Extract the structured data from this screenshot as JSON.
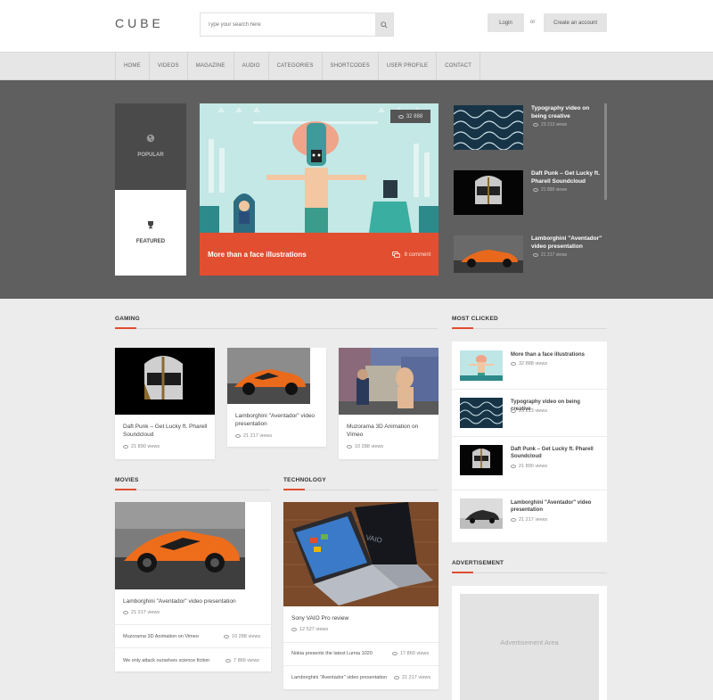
{
  "header": {
    "logo": "CUBE",
    "search_placeholder": "Type your search here",
    "login_label": "Login",
    "or_label": "or",
    "create_label": "Create an account"
  },
  "nav": {
    "items": [
      "HOME",
      "VIDEOS",
      "MAGAZINE",
      "AUDIO",
      "CATEGORIES",
      "SHORTCODES",
      "USER PROFILE",
      "CONTACT"
    ]
  },
  "hero": {
    "tabs": [
      {
        "label": "POPULAR",
        "icon": "globe-icon"
      },
      {
        "label": "FEATURED",
        "icon": "trophy-icon"
      }
    ],
    "featured": {
      "title": "More than a face illustrations",
      "views": "32 888",
      "comments": "8 comment"
    },
    "side": [
      {
        "title": "Typography video on being creative",
        "views": "23 213 views"
      },
      {
        "title": "Daft Punk – Get Lucky ft. Pharell Soundcloud",
        "views": "21 890 views"
      },
      {
        "title": "Lamborghini \"Aventador\" video presentation",
        "views": "21 217 views"
      }
    ]
  },
  "gaming": {
    "heading": "GAMING",
    "cards": [
      {
        "title": "Daft Punk – Get Lucky ft. Pharell Soundcloud",
        "views": "21 890 views"
      },
      {
        "title": "Lamborghini \"Aventador\" video presentation",
        "views": "21 217 views"
      },
      {
        "title": "Muzorama 3D Animation on Vimeo",
        "views": "10 288 views"
      }
    ]
  },
  "movies": {
    "heading": "MOVIES",
    "main": {
      "title": "Lamborghini \"Aventador\" video presentation",
      "views": "21 217 views"
    },
    "list": [
      {
        "title": "Muzorama 3D Animation on Vimeo",
        "views": "10 288 views"
      },
      {
        "title": "We only attack ourselves science fiction",
        "views": "7 866 views"
      }
    ]
  },
  "technology": {
    "heading": "TECHNOLOGY",
    "main": {
      "title": "Sony VAIO Pro review",
      "views": "12 527 views"
    },
    "list": [
      {
        "title": "Nokia presents the latest Lumia 1020",
        "views": "17 860 views"
      },
      {
        "title": "Lamborghini \"Aventador\" video presentation",
        "views": "21 217 views"
      }
    ]
  },
  "most_clicked": {
    "heading": "MOST CLICKED",
    "items": [
      {
        "title": "More than a face illustrations",
        "views": "32 888 views"
      },
      {
        "title": "Typography video on being creative",
        "views": "23 213 views"
      },
      {
        "title": "Daft Punk – Get Lucky ft. Pharell Soundcloud",
        "views": "21 890 views"
      },
      {
        "title": "Lamborghini \"Aventador\" video presentation",
        "views": "21 217 views"
      }
    ]
  },
  "advertisement": {
    "heading": "ADVERTISEMENT",
    "text": "Advertisement Area"
  },
  "colors": {
    "accent": "#e24e30",
    "hero_bg": "#5f5f5f",
    "page_bg": "#ececec"
  }
}
